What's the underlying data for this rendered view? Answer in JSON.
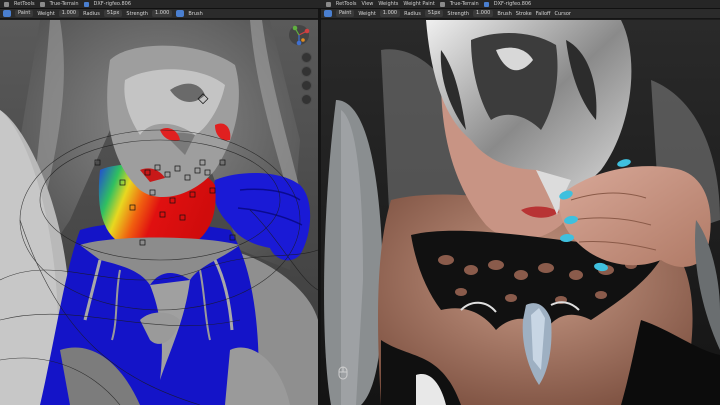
{
  "topbar": {
    "left_items": [
      "RetTools",
      "True-Terrain",
      "DXF-rigfeo.806"
    ],
    "right_items": [
      "RetTools",
      "View",
      "Weights",
      "Weight Paint",
      "True-Terrain",
      "DXF-rigfeo.806"
    ]
  },
  "left_toolbar": {
    "mode": "Paint",
    "weight_label": "Weight",
    "weight_value": "1.000",
    "radius_label": "Radius",
    "radius_value": "51px",
    "strength_label": "Strength",
    "strength_value": "1.000",
    "brush_label": "Brush"
  },
  "right_toolbar": {
    "mode": "Paint",
    "weight_label": "Weight",
    "weight_value": "1.000",
    "radius_label": "Radius",
    "radius_value": "51px",
    "strength_label": "Strength",
    "strength_value": "1.000",
    "brush_label": "Brush",
    "stroke_label": "Stroke",
    "falloff_label": "Falloff",
    "cursor_label": "Cursor"
  },
  "colors": {
    "ui_dark": "#262626",
    "accent_blue": "#4a7fd0",
    "weight_blue": "#1a1ad2",
    "weight_red": "#e01010",
    "weight_green": "#30c040",
    "weight_yellow": "#e8d820",
    "nail_cyan": "#3fc0de"
  },
  "icons": [
    "gizmo-icon",
    "zoom-icon",
    "hand-icon",
    "camera-icon",
    "grid-icon",
    "mouse-icon"
  ]
}
